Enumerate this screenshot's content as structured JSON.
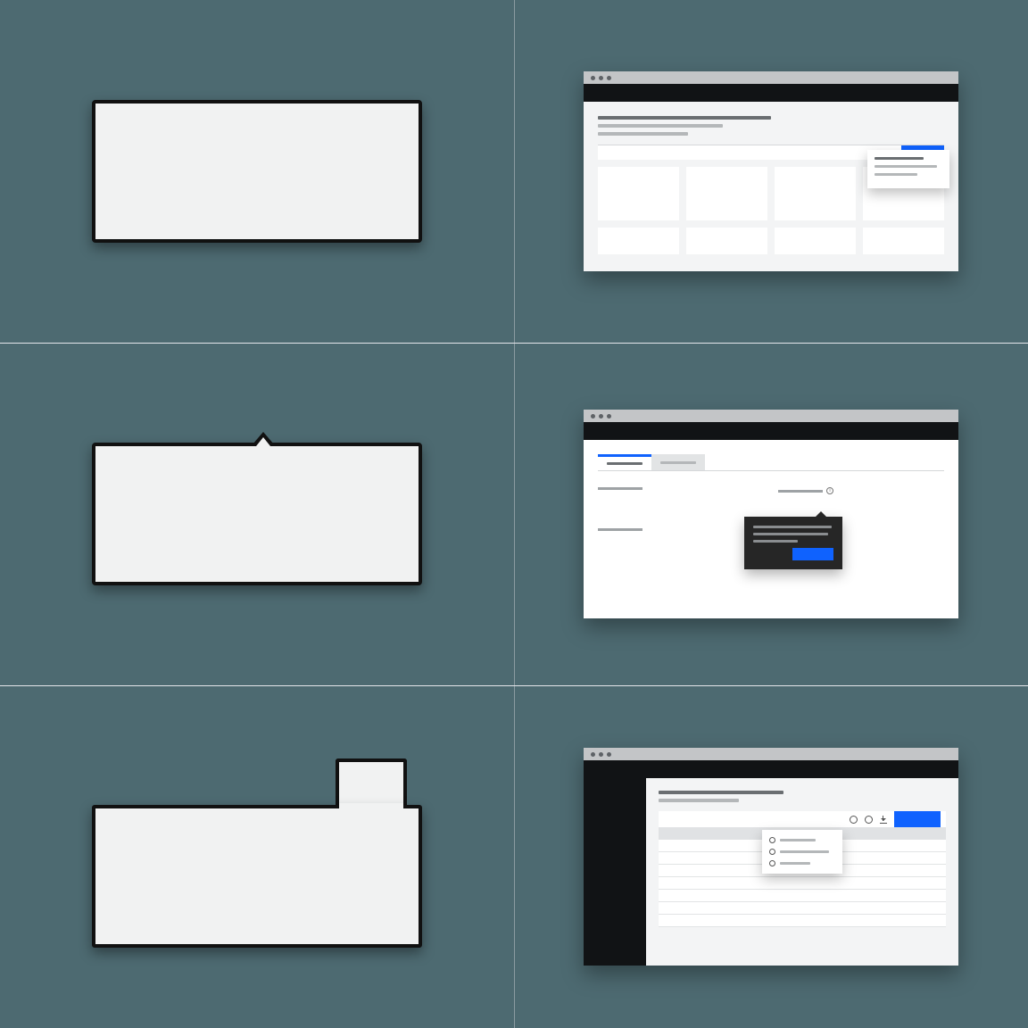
{
  "diagram": {
    "type": "popover-pattern-examples",
    "rows": [
      {
        "left_shape": "plain-popover",
        "right_example": "dropdown-menu-from-button"
      },
      {
        "left_shape": "popover-with-caret",
        "right_example": "tooltip-from-info-icon"
      },
      {
        "left_shape": "popover-with-tab-connector",
        "right_example": "settings-menu-from-toolbar-icon"
      }
    ]
  },
  "colors": {
    "background": "#4d6a71",
    "popover_fill": "#f1f2f2",
    "popover_border": "#111111",
    "primary_blue": "#0f62fe",
    "tooltip_bg": "#262626",
    "browser_chrome": "#c3c5c7",
    "browser_topbar": "#111315"
  },
  "row1": {
    "dropdown": {
      "options_count": 3
    },
    "grid_tiles": 8
  },
  "row2": {
    "tabs_count": 2,
    "tooltip_lines": 3,
    "tooltip_has_button": true
  },
  "row3": {
    "toolbar_icons": [
      "search",
      "settings",
      "download"
    ],
    "menu_options_count": 3,
    "menu_control": "radio",
    "has_sidebar": true
  }
}
